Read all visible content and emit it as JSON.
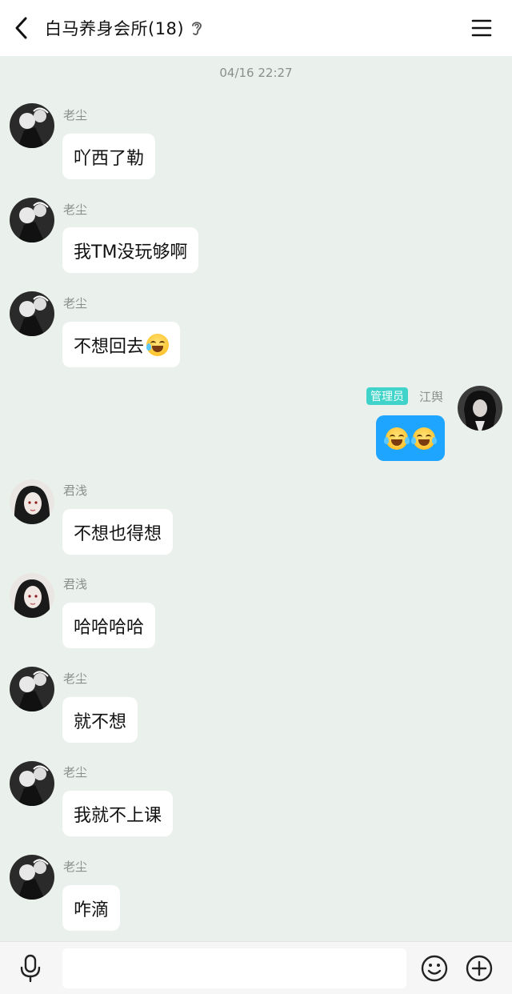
{
  "header": {
    "title": "白马养身会所(18)",
    "back_icon": "chevron-left-icon",
    "ear_icon": "ear-icon",
    "menu_icon": "menu-icon"
  },
  "chat": {
    "timestamp": "04/16 22:27",
    "messages": [
      {
        "sender": "老尘",
        "text": "吖西了勒"
      },
      {
        "sender": "老尘",
        "text": "我TM没玩够啊"
      },
      {
        "sender": "老尘",
        "text": "不想回去",
        "emoji": "crying-laughing-emoji"
      },
      {
        "sender": "江舆",
        "badge": "管理员",
        "emoji": "laughing-tears-emoji x2"
      },
      {
        "sender": "君浅",
        "text": "不想也得想"
      },
      {
        "sender": "君浅",
        "text": "哈哈哈哈"
      },
      {
        "sender": "老尘",
        "text": "就不想"
      },
      {
        "sender": "老尘",
        "text": "我就不上课"
      },
      {
        "sender": "老尘",
        "text": "咋滴"
      }
    ]
  },
  "input_bar": {
    "mic_icon": "microphone-icon",
    "input_placeholder": "",
    "emoji_icon": "smiley-icon",
    "plus_icon": "plus-circle-icon"
  },
  "colors": {
    "background": "#eaf0ec",
    "header": "#ffffff",
    "bubble_other": "#ffffff",
    "bubble_mine": "#1ea5ff",
    "admin_badge": "#3fd3c9"
  }
}
